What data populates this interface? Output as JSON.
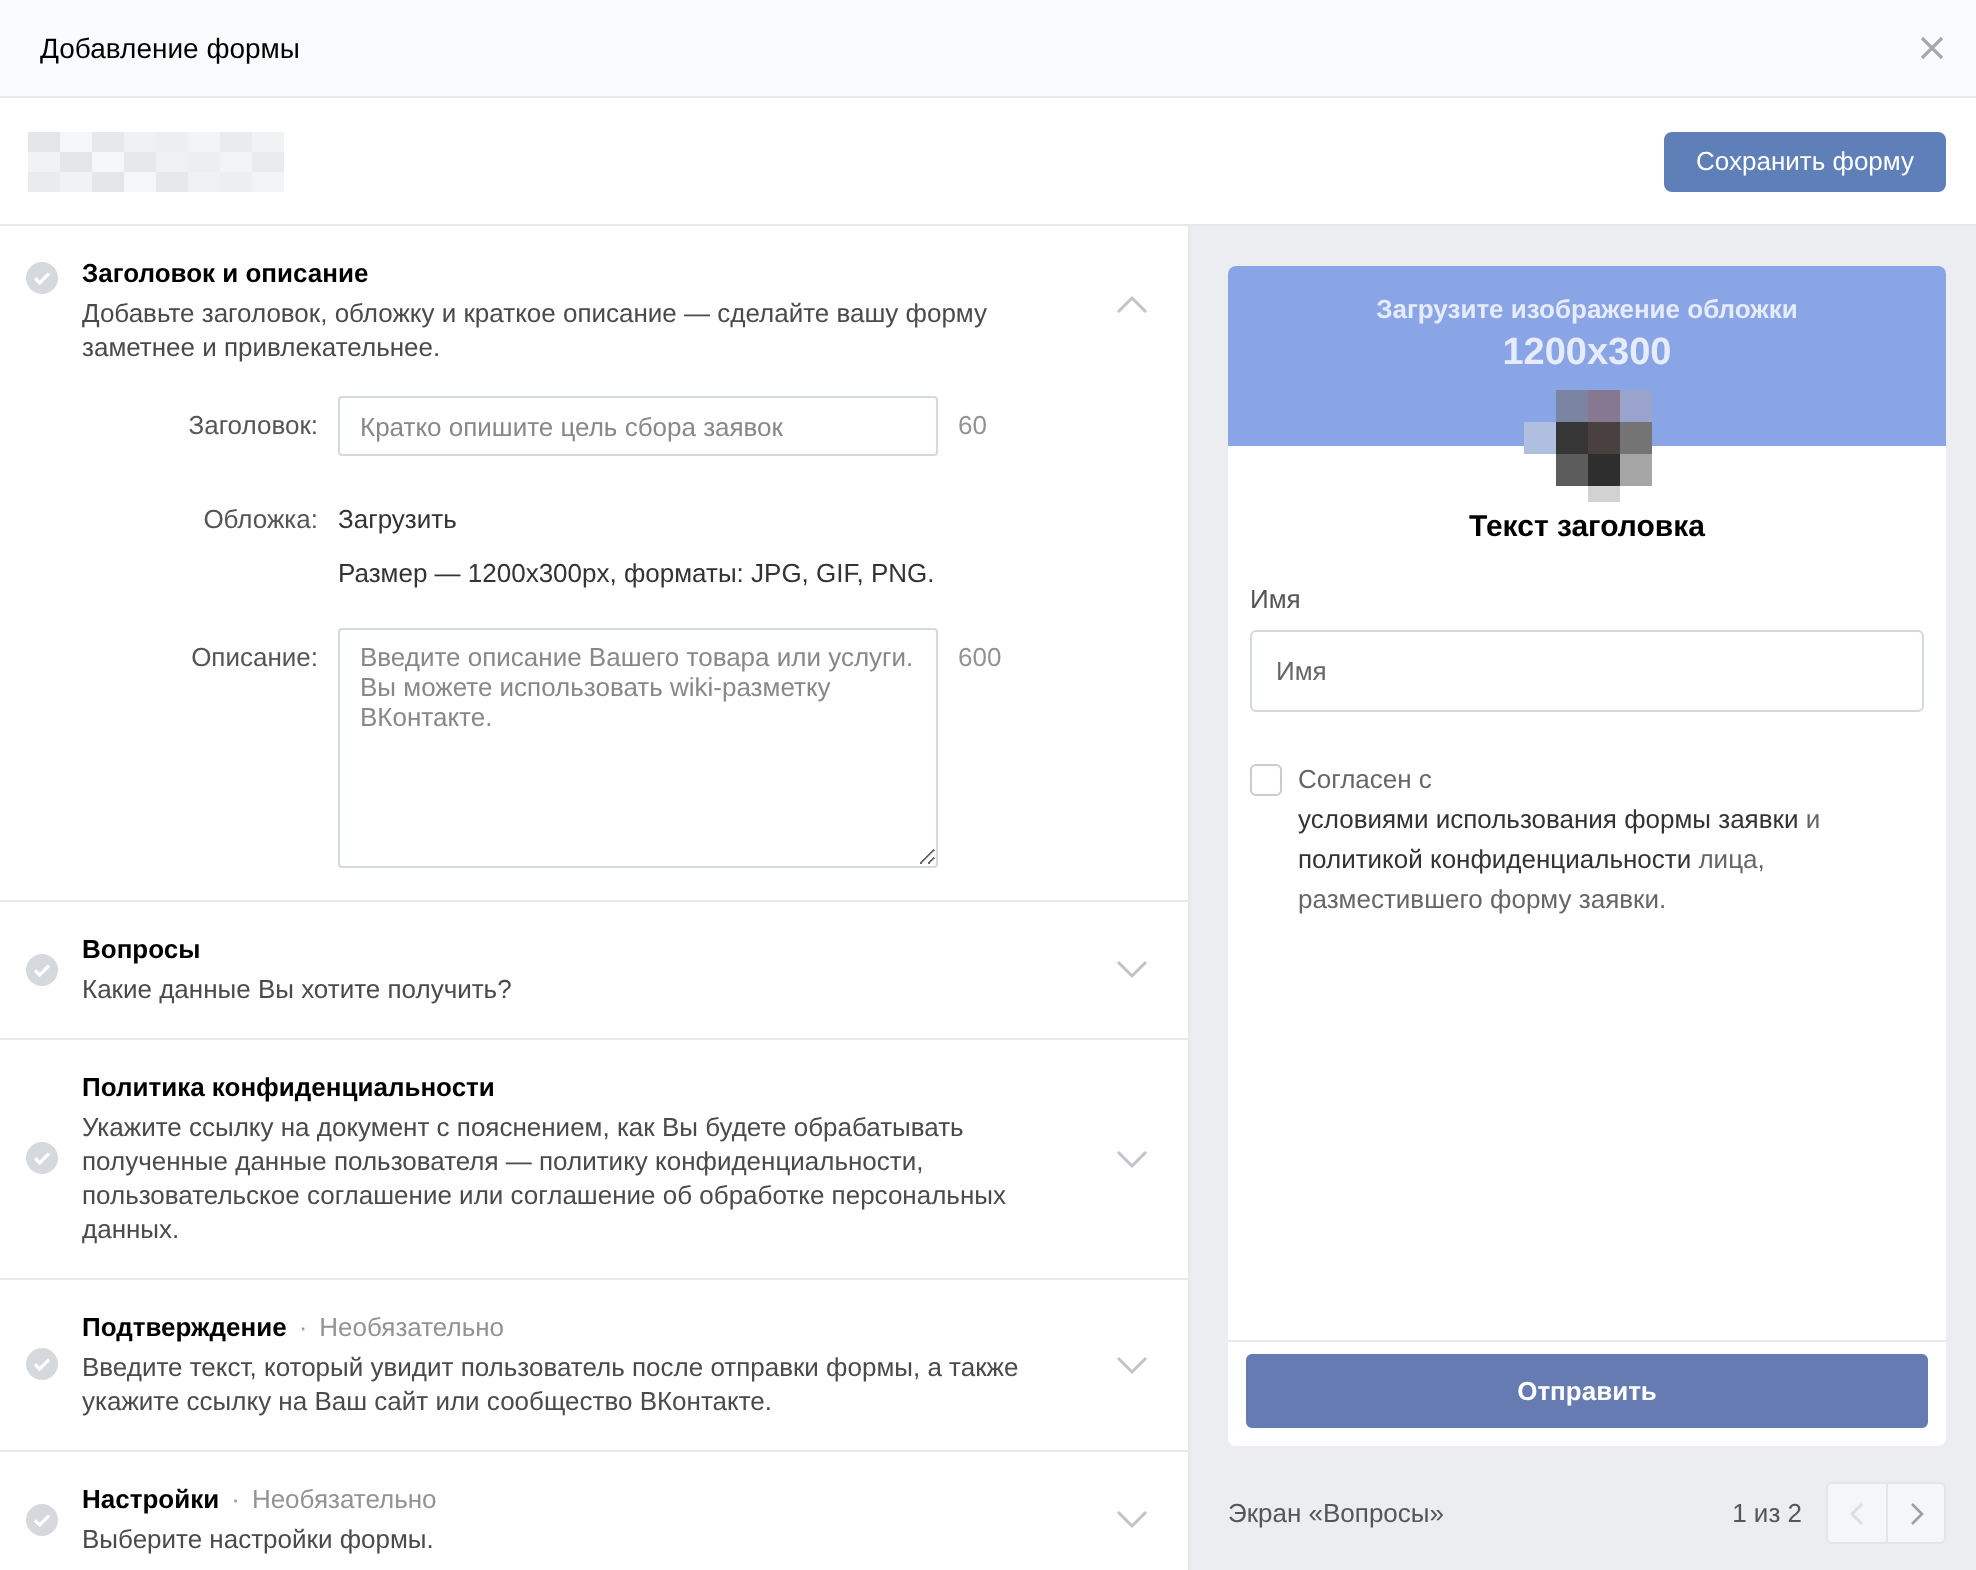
{
  "window": {
    "title": "Добавление формы"
  },
  "toolbar": {
    "save_button": "Сохранить форму"
  },
  "sections": [
    {
      "title": "Заголовок и описание",
      "description": "Добавьте заголовок, обложку и краткое описание — сделайте вашу форму заметнее и привлекательнее.",
      "expanded": true
    },
    {
      "title": "Вопросы",
      "description": "Какие данные Вы хотите получить?",
      "expanded": false
    },
    {
      "title": "Политика конфиденциальности",
      "description": "Укажите ссылку на документ с пояснением, как Вы будете обрабатывать полученные данные пользователя — политику конфиденциальности, пользовательское соглашение или соглашение об обработке персональных данных.",
      "expanded": false
    },
    {
      "title": "Подтверждение",
      "separator": "·",
      "optional": "Необязательно",
      "description": "Введите текст, который увидит пользователь после отправки формы, а также укажите ссылку на Ваш сайт или сообщество ВКонтакте.",
      "expanded": false
    },
    {
      "title": "Настройки",
      "separator": "·",
      "optional": "Необязательно",
      "description": "Выберите настройки формы.",
      "expanded": false
    }
  ],
  "fields": {
    "title": {
      "label": "Заголовок:",
      "placeholder": "Кратко опишите цель сбора заявок",
      "counter": "60"
    },
    "cover": {
      "label": "Обложка:",
      "link": "Загрузить",
      "hint": "Размер — 1200x300px, форматы: JPG, GIF, PNG."
    },
    "description": {
      "label": "Описание:",
      "placeholder": "Введите описание Вашего товара или услуги. Вы можете использовать wiki-разметку ВКонтакте.",
      "counter": "600"
    }
  },
  "preview": {
    "cover_text": "Загрузите изображение обложки",
    "cover_size": "1200x300",
    "heading": "Текст заголовка",
    "name_label": "Имя",
    "name_placeholder": "Имя",
    "agreement": {
      "checked": false,
      "parts": [
        {
          "kind": "text",
          "text": "Согласен с "
        },
        {
          "kind": "link",
          "text": "условиями использования формы заявки"
        },
        {
          "kind": "text",
          "text": " и "
        },
        {
          "kind": "link",
          "text": "политикой конфиденциальности"
        },
        {
          "kind": "text",
          "text": " лица, разместившего форму заявки."
        }
      ]
    },
    "submit": "Отправить"
  },
  "pager": {
    "screen": "Экран «Вопросы»",
    "count": "1 из 2",
    "prev_disabled": true,
    "next_disabled": false
  }
}
